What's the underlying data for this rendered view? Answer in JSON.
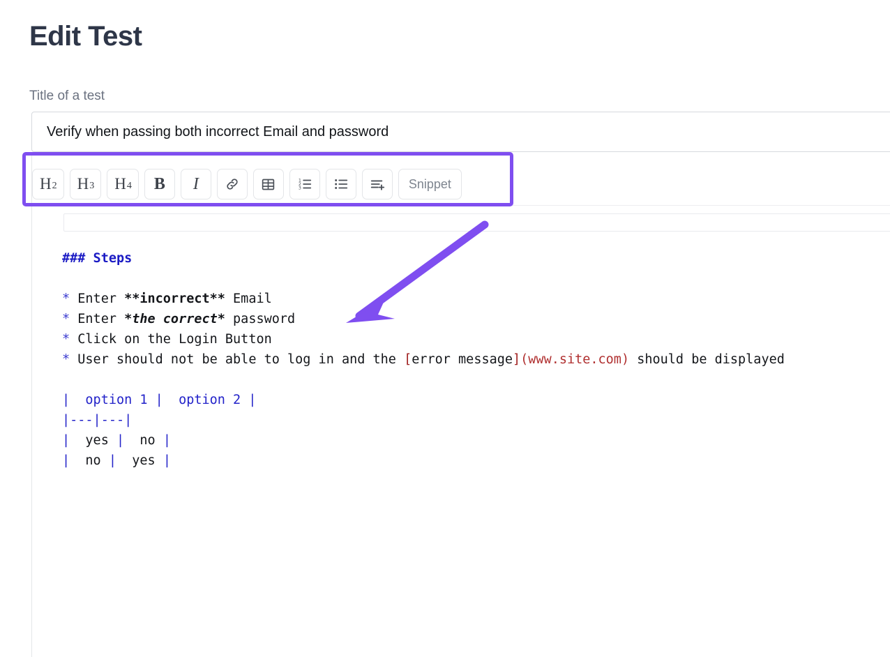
{
  "page": {
    "title": "Edit Test"
  },
  "title_field": {
    "label": "Title of a test",
    "value": "Verify when passing both incorrect Email and password",
    "placeholder": "Title of a test"
  },
  "toolbar": {
    "buttons": [
      {
        "name": "heading-2-button",
        "label": "H",
        "sub": "2",
        "kind": "head"
      },
      {
        "name": "heading-3-button",
        "label": "H",
        "sub": "3",
        "kind": "head"
      },
      {
        "name": "heading-4-button",
        "label": "H",
        "sub": "4",
        "kind": "head"
      },
      {
        "name": "bold-button",
        "label": "B",
        "sub": "",
        "kind": "bold"
      },
      {
        "name": "italic-button",
        "label": "I",
        "sub": "",
        "kind": "italic"
      },
      {
        "name": "link-button",
        "label": "",
        "sub": "",
        "kind": "icon-link"
      },
      {
        "name": "table-button",
        "label": "",
        "sub": "",
        "kind": "icon-table"
      },
      {
        "name": "ordered-list-button",
        "label": "",
        "sub": "",
        "kind": "icon-ol"
      },
      {
        "name": "bulleted-list-button",
        "label": "",
        "sub": "",
        "kind": "icon-ul"
      },
      {
        "name": "add-line-button",
        "label": "",
        "sub": "",
        "kind": "icon-lineplus"
      },
      {
        "name": "snippet-button",
        "label": "Snippet",
        "sub": "",
        "kind": "snippet"
      }
    ]
  },
  "editor": {
    "markdown_lines": [
      "### Steps",
      "",
      "* Enter **incorrect** Email",
      "* Enter *the correct* password",
      "* Click on the Login Button",
      "* User should not be able to log in and the [error message](www.site.com) should be displayed",
      "",
      "|  option 1 |  option 2 |",
      "|---|---|",
      "|  yes |  no |",
      "|  no |  yes |"
    ],
    "heading_text": "### Steps",
    "bullet_marker": "*",
    "steps": [
      {
        "prefix": "Enter ",
        "emphasis": "**incorrect**",
        "suffix": " Email",
        "emphasis_style": "bold"
      },
      {
        "prefix": "Enter ",
        "emphasis": "*the correct*",
        "suffix": " password",
        "emphasis_style": "bold-italic"
      },
      {
        "prefix": "Click on the Login Button",
        "emphasis": "",
        "suffix": "",
        "emphasis_style": "none"
      }
    ],
    "step4": {
      "prefix": "User should not be able to log in and the ",
      "link_open": "[",
      "link_text": "error message",
      "link_close": "]",
      "url": "(www.site.com)",
      "suffix": " should be displayed"
    },
    "table": {
      "header": "|  option 1 |  option 2 |",
      "separator": "|---|---|",
      "pipe": "|",
      "header_cells": [
        "option 1",
        "option 2"
      ],
      "rows": [
        [
          "yes",
          "no"
        ],
        [
          "no",
          "yes"
        ]
      ]
    }
  },
  "annotations": {
    "highlight_color": "#7f4ef0",
    "arrow_color": "#7f4ef0",
    "highlight_target": "formatting-toolbar",
    "arrow_points_to": "markdown-editor-body"
  },
  "colors": {
    "page_title": "#2e3648",
    "label": "#6b7280",
    "markdown_text": "#14161a",
    "markdown_keyword": "#2222c9",
    "markdown_heading": "#1b1bc4",
    "markdown_link_url": "#b03030",
    "border": "#e4e6e9"
  }
}
